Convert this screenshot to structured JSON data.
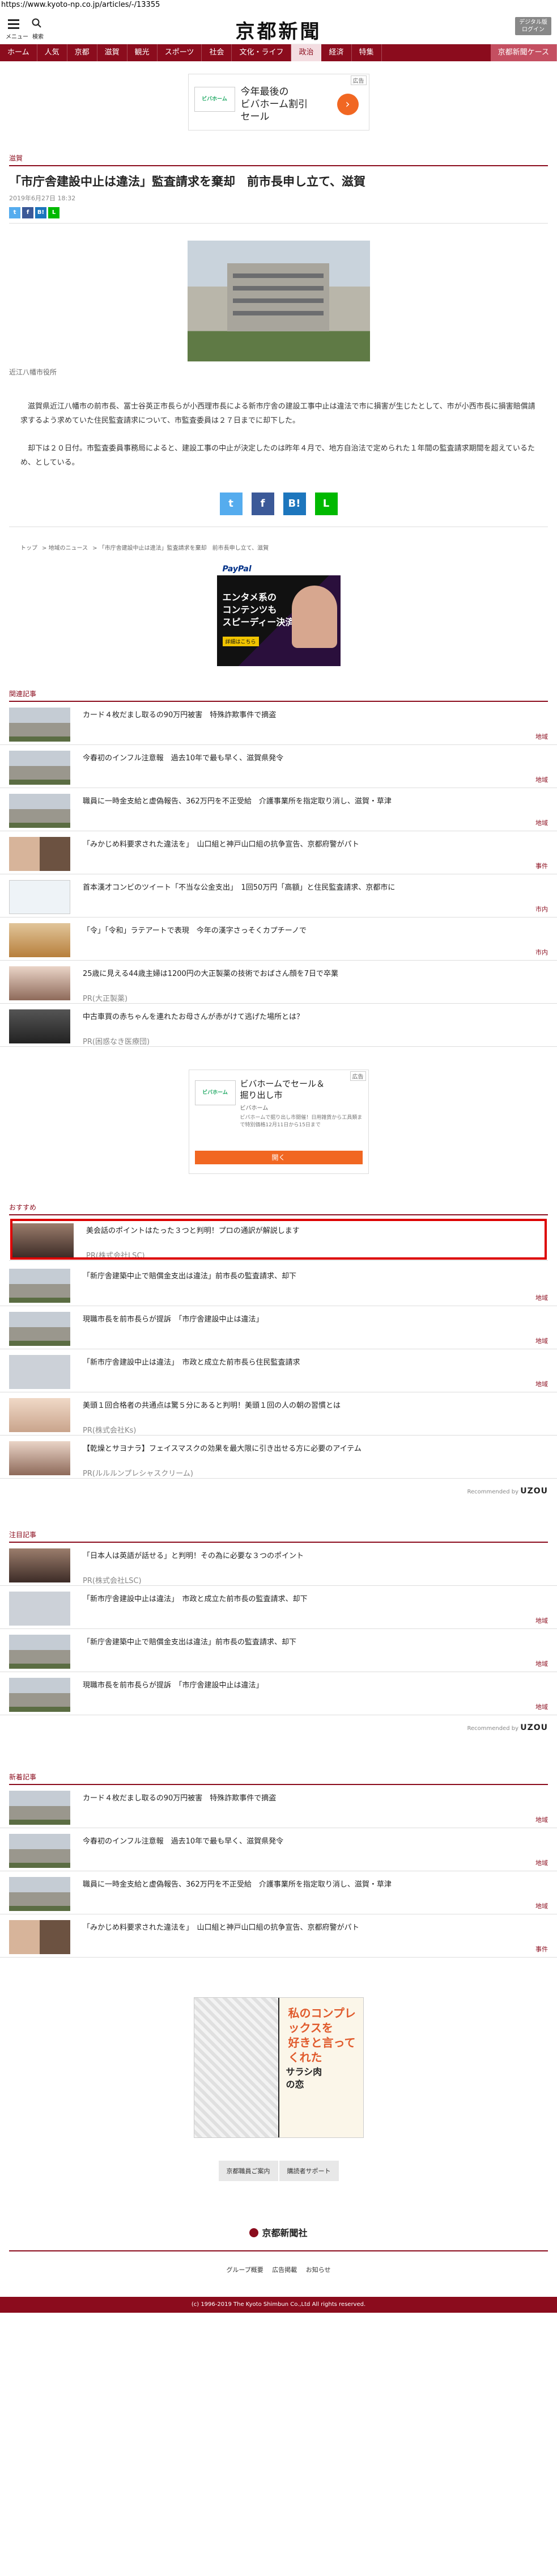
{
  "url": "https://www.kyoto-np.co.jp/articles/-/13355",
  "header": {
    "menu_label": "メニュー",
    "search_label": "検索",
    "logo": "京都新聞",
    "digital_line1": "デジタル版",
    "digital_line2": "ログイン"
  },
  "nav": [
    "ホーム",
    "人気",
    "京都",
    "滋賀",
    "観光",
    "スポーツ",
    "社会",
    "文化・ライフ",
    "政治",
    "経済",
    "特集",
    "京都新聞ケース"
  ],
  "ad_top": {
    "badge": "広告",
    "logo_text": "ビバホーム",
    "text": "今年最後の\nビバホーム割引\nセール"
  },
  "article": {
    "category": "滋賀",
    "title": "「市庁舎建設中止は違法」監査請求を棄却　前市長申し立て、滋賀",
    "date": "2019年6月27日 18:32",
    "caption": "近江八幡市役所",
    "paragraphs": [
      "滋賀県近江八幡市の前市長、冨士谷英正市長らが小西理市長による新市庁舎の建設工事中止は違法で市に損害が生じたとして、市が小西市長に損害賠償請求するよう求めていた住民監査請求について、市監査委員は２７日までに却下した。",
      "却下は２０日付。市監査委員事務局によると、建設工事の中止が決定したのは昨年４月で、地方自治法で定められた１年間の監査請求期間を超えているため、としている。"
    ],
    "breadcrumb": [
      "トップ",
      "地域のニュース",
      "「市庁舎建設中止は違法」監査請求を棄却　前市長申し立て、滋賀"
    ]
  },
  "paypal_ad": {
    "brand": "PayPal",
    "message": "エンタメ系の\nコンテンツも\nスピーディー決済！",
    "cta": "詳細はこちら"
  },
  "related": {
    "heading": "関連記事",
    "items": [
      {
        "title": "カード４枚だまし取るの90万円被害　特殊詐欺事件で摘盗",
        "cat": "地域"
      },
      {
        "title": "今春初のインフル注意報　過去10年で最も早く、滋賀県発令",
        "cat": "地域"
      },
      {
        "title": "職員に一時金支給と虚偽報告、362万円を不正受給　介護事業所を指定取り消し、滋賀・草津",
        "cat": "地域"
      },
      {
        "title": "「みかじめ料要求された違法を」　山口組と神戸山口組の抗争宣告、京都府警がパト",
        "cat": "事件"
      },
      {
        "title": "首本漢才コンビのツイート「不当な公金支出」　1回50万円「高額」と住民監査請求、京都市に",
        "cat": "市内"
      },
      {
        "title": "「令」「令和」ラテアートで表現　今年の漢字さっそくカプチーノで",
        "cat": "市内"
      },
      {
        "title": "25歳に見える44歳主婦は1200円の大正製薬の技術でおばさん顔を7日で卒業",
        "sub": "PR(大正製薬)"
      },
      {
        "title": "中古車買の赤ちゃんを連れたお母さんが赤がけて逃げた場所とは？",
        "sub": "PR(困惑なき医療団)"
      }
    ]
  },
  "mid_ad": {
    "badge": "広告",
    "logo_text": "ビバホーム",
    "headline": "ビバホームでセール＆\n掘り出し市",
    "source": "ビバホーム",
    "desc": "ビバホームで掘り出し市開催！日用雑貨から工具類まで特別価格12月11日から15日まで",
    "button": "開く"
  },
  "recommend": {
    "heading": "おすすめ",
    "items": [
      {
        "title": "美会話のポイントはたった３つと判明！プロの通訳が解説します",
        "sub": "PR(株式会社LSC)"
      },
      {
        "title": "「新庁舎建築中止で賠償金支出は違法」前市長の監査請求、却下",
        "cat": "地域"
      },
      {
        "title": "現職市長を前市長らが提訴　「市庁舎建設中止は違法」",
        "cat": "地域"
      },
      {
        "title": "「新市庁舎建設中止は違法」　市政と成立た前市長ら住民監査請求",
        "cat": "地域"
      },
      {
        "title": "美頭１回合格者の共通点は驚５分にあると判明！美頭１回の人の朝の習慣とは",
        "sub": "PR(株式会社Ks)"
      },
      {
        "title": "【乾燥とサヨナラ】フェイスマスクの効果を最大限に引き出せる方に必要のアイテム",
        "sub": "PR(ルルルンプレシャスクリーム)"
      }
    ],
    "powered_by": "Recommended by",
    "brand": "UZOU"
  },
  "attention": {
    "heading": "注目記事",
    "items": [
      {
        "title": "「日本人は英語が話せる」と判明！その為に必要な３つのポイント",
        "sub": "PR(株式会社LSC)"
      },
      {
        "title": "「新市庁舎建設中止は違法」　市政と成立た前市長の監査請求、却下",
        "cat": "地域"
      },
      {
        "title": "「新庁舎建築中止で賠償金支出は違法」前市長の監査請求、却下",
        "cat": "地域"
      },
      {
        "title": "現職市長を前市長らが提訴　「市庁舎建設中止は違法」",
        "cat": "地域"
      }
    ],
    "powered_by": "Recommended by",
    "brand": "UZOU"
  },
  "latest": {
    "heading": "新着記事",
    "items": [
      {
        "title": "カード４枚だまし取るの90万円被害　特殊詐欺事件で摘盗",
        "cat": "地域"
      },
      {
        "title": "今春初のインフル注意報　過去10年で最も早く、滋賀県発令",
        "cat": "地域"
      },
      {
        "title": "職員に一時金支給と虚偽報告、362万円を不正受給　介護事業所を指定取り消し、滋賀・草津",
        "cat": "地域"
      },
      {
        "title": "「みかじめ料要求された違法を」　山口組と神戸山口組の抗争宣告、京都府警がパト",
        "cat": "事件"
      }
    ]
  },
  "manga_ad": {
    "text_top": "私のコンプレックスを\n好きと言ってくれた",
    "text_bottom": "サラシ肉\nの恋"
  },
  "footer": {
    "buttons": [
      "京都職員ご案内",
      "購読者サポート"
    ],
    "logo": "京都新聞社",
    "links": [
      "グループ概要",
      "広告掲載",
      "お知らせ"
    ],
    "copyright": "(c) 1996-2019 The Kyoto Shimbun Co.,Ltd All rights reserved."
  }
}
